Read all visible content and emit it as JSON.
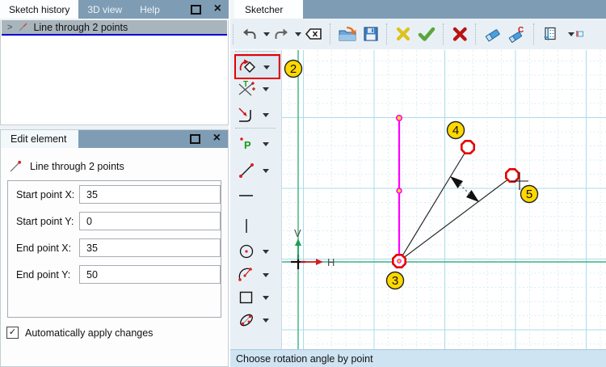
{
  "icons": {
    "close": "×",
    "expander": ">",
    "check": "✓"
  },
  "colors": {
    "callout_yellow": "#ffd800",
    "highlight_red": "#e60000",
    "magenta_line": "#ff00ff",
    "axis_green": "#3cb183",
    "selection_blue": "#0000cd"
  },
  "history_panel": {
    "tabs": [
      {
        "label": "Sketch history",
        "active": true
      },
      {
        "label": "3D view",
        "active": false
      },
      {
        "label": "Help",
        "active": false
      }
    ],
    "item_label": "Line through 2 points"
  },
  "edit_panel": {
    "title": "Edit element",
    "element_label": "Line through 2 points",
    "fields": [
      {
        "label": "Start point X:",
        "value": "35"
      },
      {
        "label": "Start point Y:",
        "value": "0"
      },
      {
        "label": "End point X:",
        "value": "35"
      },
      {
        "label": "End point Y:",
        "value": "50"
      }
    ],
    "auto_apply_label": "Automatically apply changes",
    "auto_apply_checked": true
  },
  "sketcher": {
    "tab_label": "Sketcher",
    "status_text": "Choose rotation angle by point",
    "axis_v": "V",
    "axis_h": "H",
    "eraser_c_label": "C",
    "tool_point_label": "P",
    "tool_trim_label": "T",
    "callouts": {
      "c2": "2",
      "c3": "3",
      "c4": "4",
      "c5": "5"
    }
  }
}
